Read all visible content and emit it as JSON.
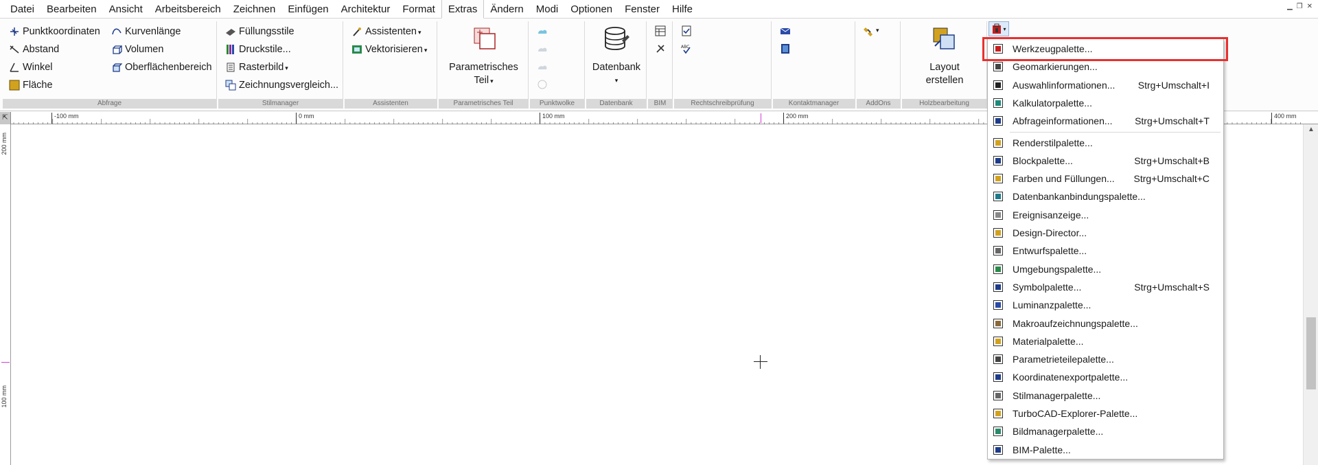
{
  "menubar": {
    "items": [
      "Datei",
      "Bearbeiten",
      "Ansicht",
      "Arbeitsbereich",
      "Zeichnen",
      "Einfügen",
      "Architektur",
      "Format",
      "Extras",
      "Ändern",
      "Modi",
      "Optionen",
      "Fenster",
      "Hilfe"
    ],
    "active": "Extras"
  },
  "ribbon": {
    "abfrage": {
      "label": "Abfrage",
      "punktkoordinaten": "Punktkoordinaten",
      "abstand": "Abstand",
      "winkel": "Winkel",
      "flaeche": "Fläche",
      "kurvenlaenge": "Kurvenlänge",
      "volumen": "Volumen",
      "oberflaechenbereich": "Oberflächenbereich"
    },
    "stilmanager": {
      "label": "Stilmanager",
      "fuellungsstile": "Füllungsstile",
      "druckstile": "Druckstile...",
      "rasterbild": "Rasterbild",
      "zeichnungsvergleich": "Zeichnungsvergleich..."
    },
    "assistenten": {
      "label": "Assistenten",
      "assistenten": "Assistenten",
      "vektorisieren": "Vektorisieren"
    },
    "parametrisch": {
      "label": "Parametrisches Teil",
      "button_line1": "Parametrisches",
      "button_line2": "Teil"
    },
    "punktwolke": {
      "label": "Punktwolke"
    },
    "datenbank": {
      "label": "Datenbank",
      "button": "Datenbank"
    },
    "bim": {
      "label": "BIM"
    },
    "rechtschreib": {
      "label": "Rechtschreibprüfung"
    },
    "kontakt": {
      "label": "Kontaktmanager"
    },
    "addons": {
      "label": "AddOns"
    },
    "holz": {
      "label": "Holzbearbeitung",
      "button_line1": "Layout",
      "button_line2": "erstellen"
    }
  },
  "ruler": {
    "h_labels": [
      "-100 mm",
      "0 mm",
      "100 mm",
      "200 mm",
      "400 mm"
    ],
    "v_labels": [
      "200 mm",
      "100 mm"
    ]
  },
  "dropdown": {
    "items": [
      {
        "label": "Werkzeugpalette...",
        "shortcut": "",
        "icon": "toolbox-icon"
      },
      {
        "label": "Geomarkierungen...",
        "shortcut": "",
        "icon": "geomarker-icon"
      },
      {
        "label": "Auswahlinformationen...",
        "shortcut": "Strg+Umschalt+I",
        "icon": "pointer-icon"
      },
      {
        "label": "Kalkulatorpalette...",
        "shortcut": "",
        "icon": "calculator-icon"
      },
      {
        "label": "Abfrageinformationen...",
        "shortcut": "Strg+Umschalt+T",
        "icon": "query-icon"
      },
      {
        "label": "Renderstilpalette...",
        "shortcut": "",
        "icon": "render-icon"
      },
      {
        "label": "Blockpalette...",
        "shortcut": "Strg+Umschalt+B",
        "icon": "block-icon"
      },
      {
        "label": "Farben und Füllungen...",
        "shortcut": "Strg+Umschalt+C",
        "icon": "colors-icon"
      },
      {
        "label": "Datenbankanbindungspalette...",
        "shortcut": "",
        "icon": "database-link-icon"
      },
      {
        "label": "Ereignisanzeige...",
        "shortcut": "",
        "icon": "event-icon"
      },
      {
        "label": "Design-Director...",
        "shortcut": "",
        "icon": "design-director-icon"
      },
      {
        "label": "Entwurfspalette...",
        "shortcut": "",
        "icon": "draft-icon"
      },
      {
        "label": "Umgebungspalette...",
        "shortcut": "",
        "icon": "environment-icon"
      },
      {
        "label": "Symbolpalette...",
        "shortcut": "Strg+Umschalt+S",
        "icon": "symbol-icon"
      },
      {
        "label": "Luminanzpalette...",
        "shortcut": "",
        "icon": "luminance-icon"
      },
      {
        "label": "Makroaufzeichnungspalette...",
        "shortcut": "",
        "icon": "macro-icon"
      },
      {
        "label": "Materialpalette...",
        "shortcut": "",
        "icon": "material-icon"
      },
      {
        "label": "Parametrieteilepalette...",
        "shortcut": "",
        "icon": "parametric-parts-icon"
      },
      {
        "label": "Koordinatenexportpalette...",
        "shortcut": "",
        "icon": "coordinate-export-icon"
      },
      {
        "label": "Stilmanagerpalette...",
        "shortcut": "",
        "icon": "style-manager-icon"
      },
      {
        "label": "TurboCAD-Explorer-Palette...",
        "shortcut": "",
        "icon": "explorer-icon"
      },
      {
        "label": "Bildmanagerpalette...",
        "shortcut": "",
        "icon": "image-manager-icon"
      },
      {
        "label": "BIM-Palette...",
        "shortcut": "",
        "icon": "bim-icon"
      }
    ]
  },
  "colors": {
    "accent": "#e8302e",
    "active_tab": "#fcfcfc",
    "group_label_bg": "#d9d9d9"
  }
}
